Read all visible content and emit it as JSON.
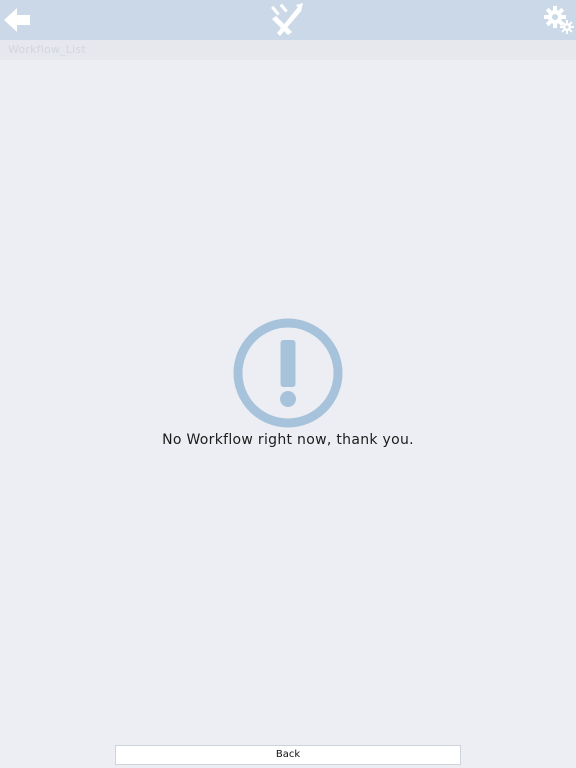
{
  "header": {
    "back_icon": "arrow-left-icon",
    "logo_icon": "pen-tool-logo-icon",
    "settings_icon": "gear-icon",
    "bar_color": "#cad8e8",
    "icon_color": "#ffffff"
  },
  "subheader": {
    "title": "Workflow_List"
  },
  "empty_state": {
    "icon": "exclamation-circle-icon",
    "icon_color": "#a7c3dc",
    "message": "No Workflow right now, thank you."
  },
  "footer": {
    "back_label": "Back"
  }
}
